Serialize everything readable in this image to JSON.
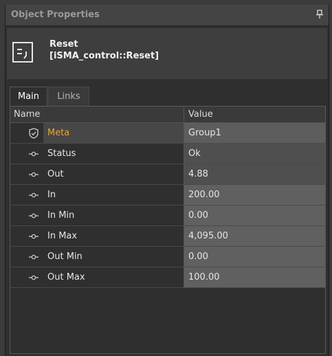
{
  "panel": {
    "title": "Object Properties",
    "pin_icon": "pin-icon"
  },
  "component": {
    "icon": "reset-component-icon",
    "name": "Reset",
    "type": "[iSMA_control::Reset]"
  },
  "tabs": [
    {
      "label": "Main",
      "active": true
    },
    {
      "label": "Links",
      "active": false
    }
  ],
  "grid": {
    "headers": {
      "name": "Name",
      "value": "Value"
    },
    "rows": [
      {
        "name": "Meta",
        "value": "Group1",
        "icon": "shield-check-icon"
      },
      {
        "name": "Status",
        "value": "Ok",
        "icon": "slot-connector-icon"
      },
      {
        "name": "Out",
        "value": "4.88",
        "icon": "slot-connector-icon"
      },
      {
        "name": "In",
        "value": "200.00",
        "icon": "slot-connector-icon"
      },
      {
        "name": "In Min",
        "value": "0.00",
        "icon": "slot-connector-icon"
      },
      {
        "name": "In Max",
        "value": "4,095.00",
        "icon": "slot-connector-icon"
      },
      {
        "name": "Out Min",
        "value": "0.00",
        "icon": "slot-connector-icon"
      },
      {
        "name": "Out Max",
        "value": "100.00",
        "icon": "slot-connector-icon"
      }
    ]
  },
  "colors": {
    "meta_label": "#e3a532",
    "panel_bg": "#2f2f2f"
  }
}
